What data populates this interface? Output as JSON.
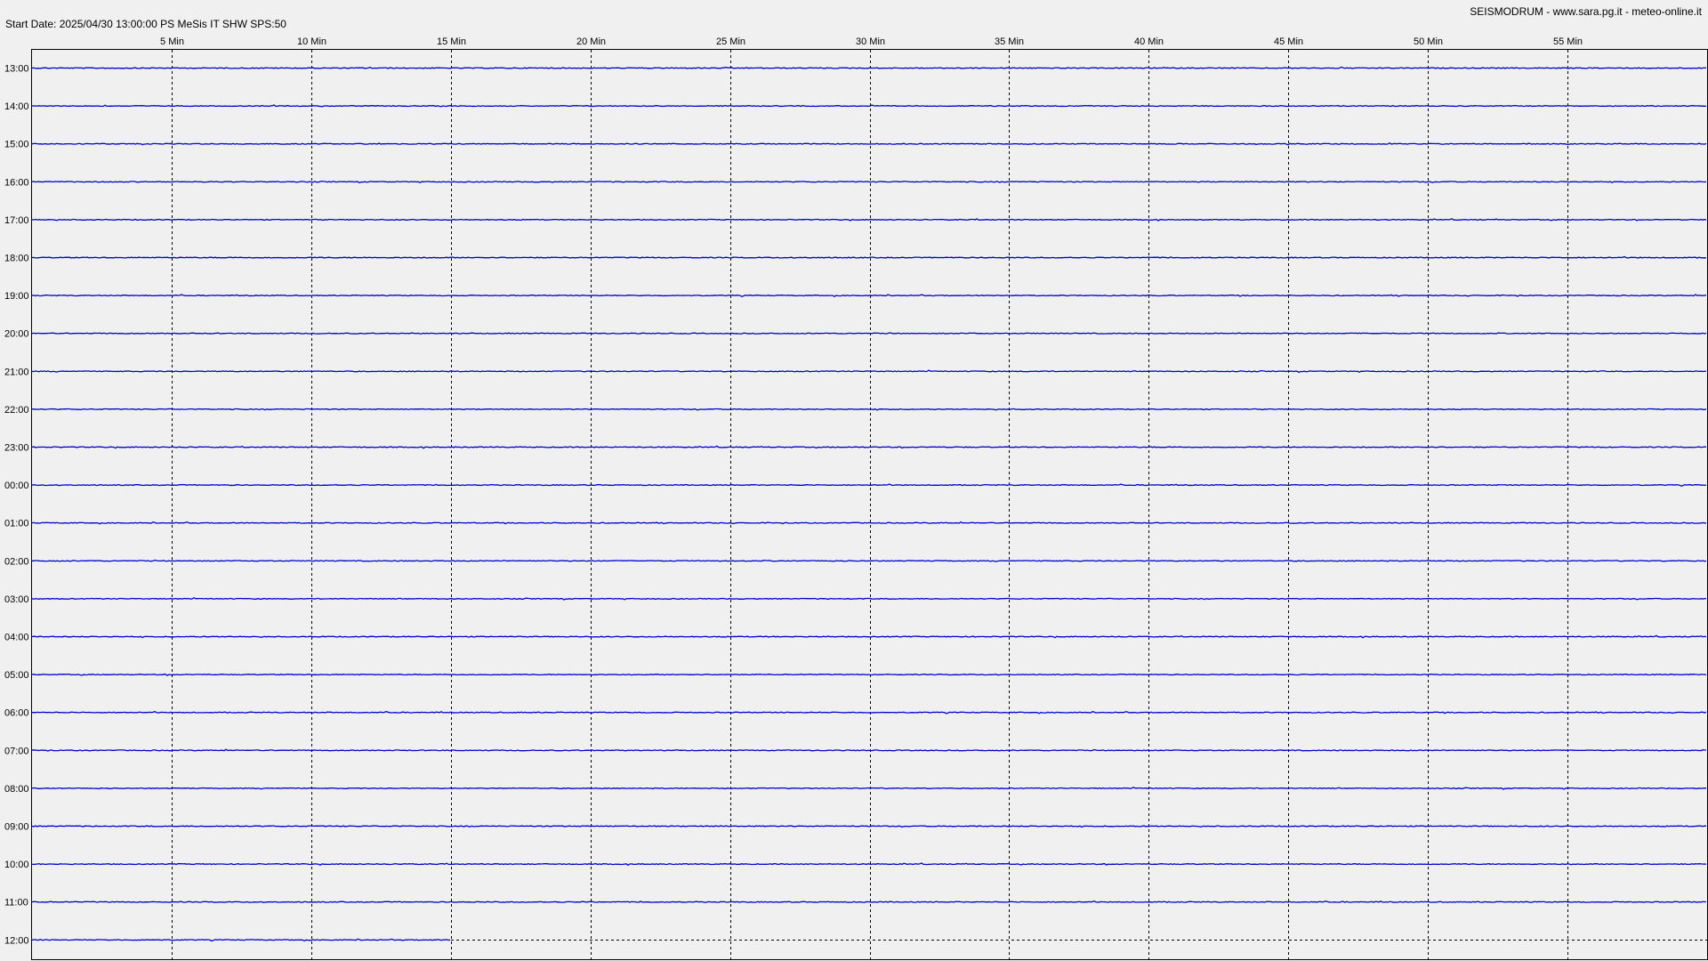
{
  "header": {
    "start_label": "Start Date: 2025/04/30 13:00:00 PS MeSis IT SHW SPS:50",
    "credit": "SEISMODRUM - www.sara.pg.it - meteo-online.it"
  },
  "colors": {
    "background": "#f0f0f0",
    "trace": "#0000cc",
    "grid": "#000000",
    "frame": "#000000"
  },
  "chart_data": {
    "type": "line",
    "title": "",
    "xlabel": "",
    "ylabel": "",
    "x_range_minutes": [
      0,
      60
    ],
    "x_ticks": [
      {
        "minute": 5,
        "label": "5 Min"
      },
      {
        "minute": 10,
        "label": "10 Min"
      },
      {
        "minute": 15,
        "label": "15 Min"
      },
      {
        "minute": 20,
        "label": "20 Min"
      },
      {
        "minute": 25,
        "label": "25 Min"
      },
      {
        "minute": 30,
        "label": "30 Min"
      },
      {
        "minute": 35,
        "label": "35 Min"
      },
      {
        "minute": 40,
        "label": "40 Min"
      },
      {
        "minute": 45,
        "label": "45 Min"
      },
      {
        "minute": 50,
        "label": "50 Min"
      },
      {
        "minute": 55,
        "label": "55 Min"
      }
    ],
    "grid": true,
    "rows": [
      {
        "label": "13:00",
        "minutes_recorded": 60
      },
      {
        "label": "14:00",
        "minutes_recorded": 60
      },
      {
        "label": "15:00",
        "minutes_recorded": 60
      },
      {
        "label": "16:00",
        "minutes_recorded": 60
      },
      {
        "label": "17:00",
        "minutes_recorded": 60
      },
      {
        "label": "18:00",
        "minutes_recorded": 60
      },
      {
        "label": "19:00",
        "minutes_recorded": 60
      },
      {
        "label": "20:00",
        "minutes_recorded": 60
      },
      {
        "label": "21:00",
        "minutes_recorded": 60
      },
      {
        "label": "22:00",
        "minutes_recorded": 60
      },
      {
        "label": "23:00",
        "minutes_recorded": 60
      },
      {
        "label": "00:00",
        "minutes_recorded": 60
      },
      {
        "label": "01:00",
        "minutes_recorded": 60
      },
      {
        "label": "02:00",
        "minutes_recorded": 60
      },
      {
        "label": "03:00",
        "minutes_recorded": 60
      },
      {
        "label": "04:00",
        "minutes_recorded": 60
      },
      {
        "label": "05:00",
        "minutes_recorded": 60
      },
      {
        "label": "06:00",
        "minutes_recorded": 60
      },
      {
        "label": "07:00",
        "minutes_recorded": 60
      },
      {
        "label": "08:00",
        "minutes_recorded": 60
      },
      {
        "label": "09:00",
        "minutes_recorded": 60
      },
      {
        "label": "10:00",
        "minutes_recorded": 60
      },
      {
        "label": "11:00",
        "minutes_recorded": 60
      },
      {
        "label": "12:00",
        "minutes_recorded": 15
      }
    ]
  }
}
